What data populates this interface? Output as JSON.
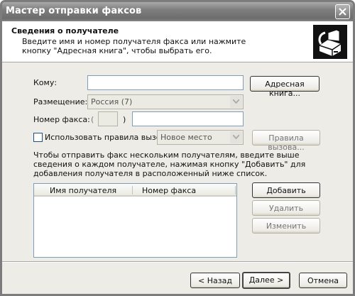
{
  "window": {
    "title": "Мастер отправки факсов"
  },
  "header": {
    "title": "Сведения о получателе",
    "subtitle": "Введите имя и номер получателя факса или нажмите кнопку \"Адресная книга\", чтобы выбрать его.",
    "icon": "fax-machine-icon"
  },
  "form": {
    "to_label": "Кому:",
    "to_value": "",
    "address_book_button": "Адресная книга...",
    "location_label": "Размещение:",
    "location_value": "Россия (7)",
    "fax_number_label": "Номер факса:",
    "area_code_open": "(",
    "area_code_close": ")",
    "area_code_value": "",
    "fax_number_value": "",
    "dialing_rules_label": "Использовать правила вызова",
    "dialing_rules_checked": false,
    "dialing_location_value": "Новое место",
    "dialing_rules_button": "Правила вызова...",
    "instructions": "Чтобы отправить факс нескольким получателям, введите выше сведения о каждом получателе, нажимая кнопку \"Добавить\" для добавления получателя в расположенный ниже список."
  },
  "recipients_list": {
    "columns": [
      "Имя получателя",
      "Номер факса"
    ],
    "rows": []
  },
  "list_buttons": {
    "add": "Добавить",
    "remove": "Удалить",
    "edit": "Изменить"
  },
  "footer": {
    "back": "< Назад",
    "next": "Далее >",
    "cancel": "Отмена"
  }
}
